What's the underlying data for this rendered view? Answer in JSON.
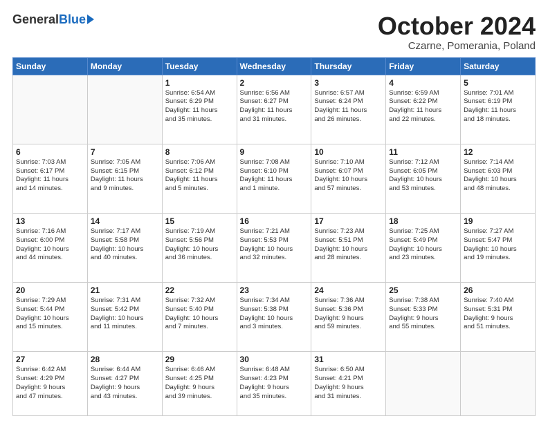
{
  "header": {
    "logo_general": "General",
    "logo_blue": "Blue",
    "month_title": "October 2024",
    "location": "Czarne, Pomerania, Poland"
  },
  "days_of_week": [
    "Sunday",
    "Monday",
    "Tuesday",
    "Wednesday",
    "Thursday",
    "Friday",
    "Saturday"
  ],
  "weeks": [
    [
      {
        "day": "",
        "content": ""
      },
      {
        "day": "",
        "content": ""
      },
      {
        "day": "1",
        "content": "Sunrise: 6:54 AM\nSunset: 6:29 PM\nDaylight: 11 hours\nand 35 minutes."
      },
      {
        "day": "2",
        "content": "Sunrise: 6:56 AM\nSunset: 6:27 PM\nDaylight: 11 hours\nand 31 minutes."
      },
      {
        "day": "3",
        "content": "Sunrise: 6:57 AM\nSunset: 6:24 PM\nDaylight: 11 hours\nand 26 minutes."
      },
      {
        "day": "4",
        "content": "Sunrise: 6:59 AM\nSunset: 6:22 PM\nDaylight: 11 hours\nand 22 minutes."
      },
      {
        "day": "5",
        "content": "Sunrise: 7:01 AM\nSunset: 6:19 PM\nDaylight: 11 hours\nand 18 minutes."
      }
    ],
    [
      {
        "day": "6",
        "content": "Sunrise: 7:03 AM\nSunset: 6:17 PM\nDaylight: 11 hours\nand 14 minutes."
      },
      {
        "day": "7",
        "content": "Sunrise: 7:05 AM\nSunset: 6:15 PM\nDaylight: 11 hours\nand 9 minutes."
      },
      {
        "day": "8",
        "content": "Sunrise: 7:06 AM\nSunset: 6:12 PM\nDaylight: 11 hours\nand 5 minutes."
      },
      {
        "day": "9",
        "content": "Sunrise: 7:08 AM\nSunset: 6:10 PM\nDaylight: 11 hours\nand 1 minute."
      },
      {
        "day": "10",
        "content": "Sunrise: 7:10 AM\nSunset: 6:07 PM\nDaylight: 10 hours\nand 57 minutes."
      },
      {
        "day": "11",
        "content": "Sunrise: 7:12 AM\nSunset: 6:05 PM\nDaylight: 10 hours\nand 53 minutes."
      },
      {
        "day": "12",
        "content": "Sunrise: 7:14 AM\nSunset: 6:03 PM\nDaylight: 10 hours\nand 48 minutes."
      }
    ],
    [
      {
        "day": "13",
        "content": "Sunrise: 7:16 AM\nSunset: 6:00 PM\nDaylight: 10 hours\nand 44 minutes."
      },
      {
        "day": "14",
        "content": "Sunrise: 7:17 AM\nSunset: 5:58 PM\nDaylight: 10 hours\nand 40 minutes."
      },
      {
        "day": "15",
        "content": "Sunrise: 7:19 AM\nSunset: 5:56 PM\nDaylight: 10 hours\nand 36 minutes."
      },
      {
        "day": "16",
        "content": "Sunrise: 7:21 AM\nSunset: 5:53 PM\nDaylight: 10 hours\nand 32 minutes."
      },
      {
        "day": "17",
        "content": "Sunrise: 7:23 AM\nSunset: 5:51 PM\nDaylight: 10 hours\nand 28 minutes."
      },
      {
        "day": "18",
        "content": "Sunrise: 7:25 AM\nSunset: 5:49 PM\nDaylight: 10 hours\nand 23 minutes."
      },
      {
        "day": "19",
        "content": "Sunrise: 7:27 AM\nSunset: 5:47 PM\nDaylight: 10 hours\nand 19 minutes."
      }
    ],
    [
      {
        "day": "20",
        "content": "Sunrise: 7:29 AM\nSunset: 5:44 PM\nDaylight: 10 hours\nand 15 minutes."
      },
      {
        "day": "21",
        "content": "Sunrise: 7:31 AM\nSunset: 5:42 PM\nDaylight: 10 hours\nand 11 minutes."
      },
      {
        "day": "22",
        "content": "Sunrise: 7:32 AM\nSunset: 5:40 PM\nDaylight: 10 hours\nand 7 minutes."
      },
      {
        "day": "23",
        "content": "Sunrise: 7:34 AM\nSunset: 5:38 PM\nDaylight: 10 hours\nand 3 minutes."
      },
      {
        "day": "24",
        "content": "Sunrise: 7:36 AM\nSunset: 5:36 PM\nDaylight: 9 hours\nand 59 minutes."
      },
      {
        "day": "25",
        "content": "Sunrise: 7:38 AM\nSunset: 5:33 PM\nDaylight: 9 hours\nand 55 minutes."
      },
      {
        "day": "26",
        "content": "Sunrise: 7:40 AM\nSunset: 5:31 PM\nDaylight: 9 hours\nand 51 minutes."
      }
    ],
    [
      {
        "day": "27",
        "content": "Sunrise: 6:42 AM\nSunset: 4:29 PM\nDaylight: 9 hours\nand 47 minutes."
      },
      {
        "day": "28",
        "content": "Sunrise: 6:44 AM\nSunset: 4:27 PM\nDaylight: 9 hours\nand 43 minutes."
      },
      {
        "day": "29",
        "content": "Sunrise: 6:46 AM\nSunset: 4:25 PM\nDaylight: 9 hours\nand 39 minutes."
      },
      {
        "day": "30",
        "content": "Sunrise: 6:48 AM\nSunset: 4:23 PM\nDaylight: 9 hours\nand 35 minutes."
      },
      {
        "day": "31",
        "content": "Sunrise: 6:50 AM\nSunset: 4:21 PM\nDaylight: 9 hours\nand 31 minutes."
      },
      {
        "day": "",
        "content": ""
      },
      {
        "day": "",
        "content": ""
      }
    ]
  ]
}
